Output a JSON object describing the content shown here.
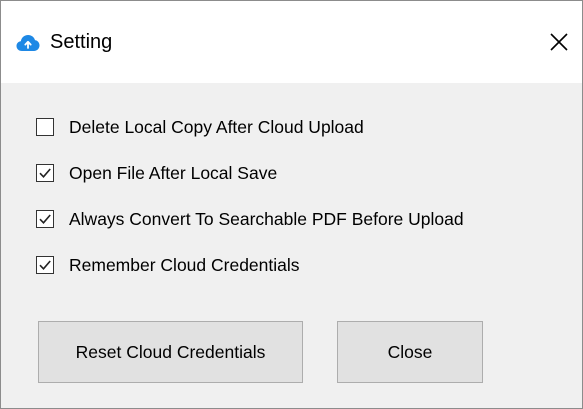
{
  "window": {
    "title": "Setting",
    "app_icon": "cloud-icon",
    "close_glyph": "close-icon"
  },
  "options": [
    {
      "label": "Delete Local Copy After Cloud Upload",
      "checked": false
    },
    {
      "label": "Open File After Local Save",
      "checked": true
    },
    {
      "label": "Always Convert To Searchable PDF Before Upload",
      "checked": true
    },
    {
      "label": "Remember Cloud Credentials",
      "checked": true
    }
  ],
  "buttons": {
    "reset_label": "Reset Cloud Credentials",
    "close_label": "Close"
  },
  "colors": {
    "accent": "#1e88e5",
    "dialog_bg": "#f0f0f0",
    "button_bg": "#e1e1e1"
  }
}
